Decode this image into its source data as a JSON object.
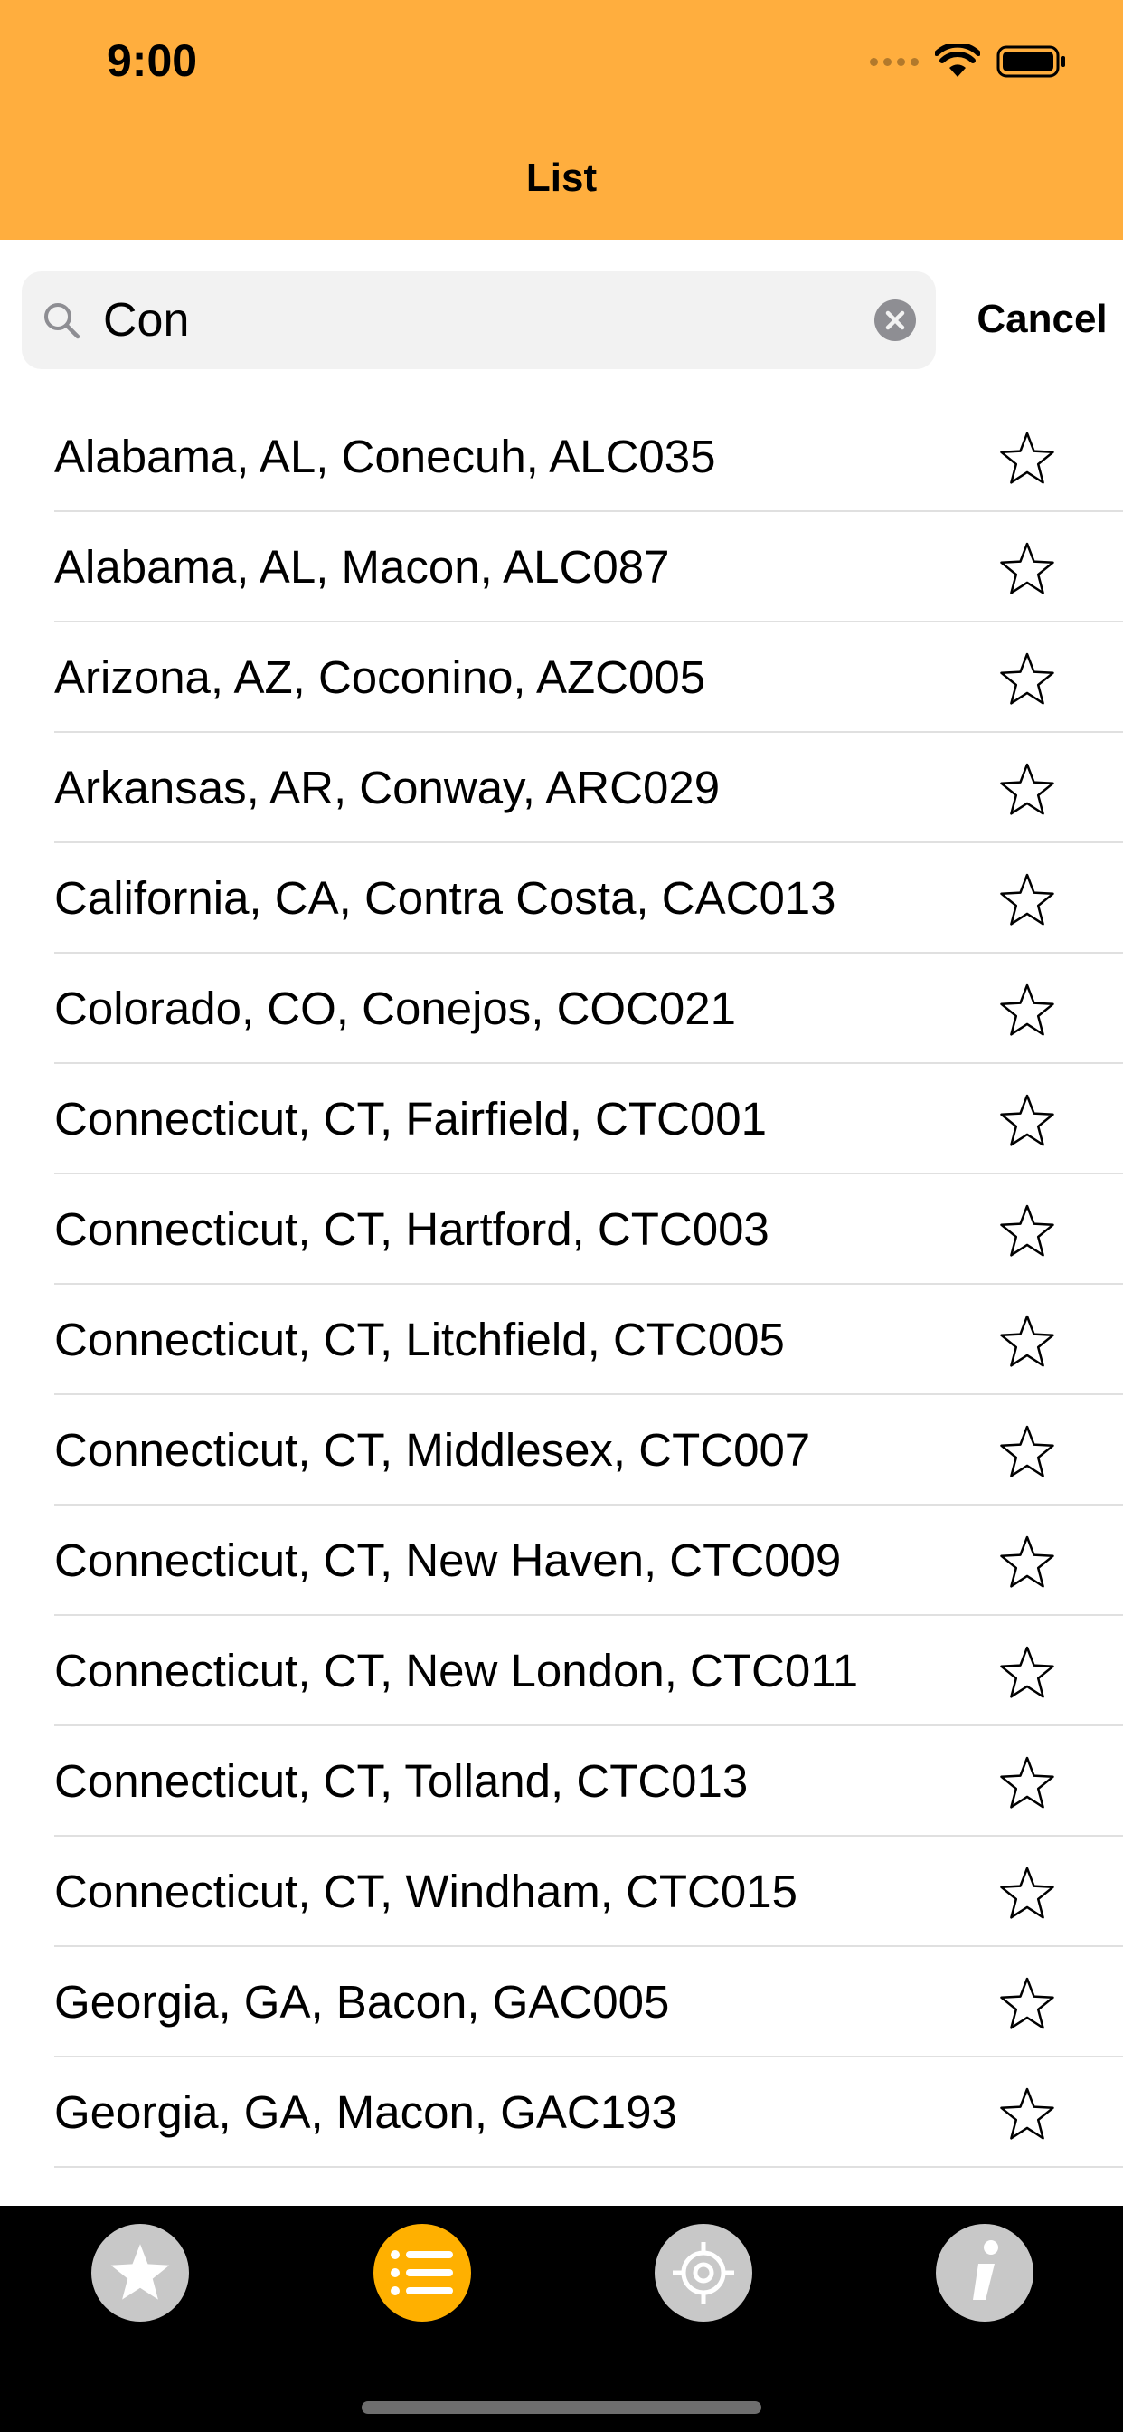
{
  "status_bar": {
    "time": "9:00"
  },
  "nav": {
    "title": "List"
  },
  "search": {
    "value": "Con",
    "cancel_label": "Cancel"
  },
  "list": {
    "items": [
      "Alabama, AL, Conecuh, ALC035",
      "Alabama, AL, Macon, ALC087",
      "Arizona, AZ, Coconino, AZC005",
      "Arkansas, AR, Conway, ARC029",
      "California, CA, Contra Costa, CAC013",
      "Colorado, CO, Conejos, COC021",
      "Connecticut, CT, Fairfield, CTC001",
      "Connecticut, CT, Hartford, CTC003",
      "Connecticut, CT, Litchfield, CTC005",
      "Connecticut, CT, Middlesex, CTC007",
      "Connecticut, CT, New Haven, CTC009",
      "Connecticut, CT, New London, CTC011",
      "Connecticut, CT, Tolland, CTC013",
      "Connecticut, CT, Windham, CTC015",
      "Georgia, GA, Bacon, GAC005",
      "Georgia, GA, Macon, GAC193"
    ]
  },
  "tabs": [
    {
      "icon": "star-icon",
      "active": false
    },
    {
      "icon": "list-icon",
      "active": true
    },
    {
      "icon": "location-target-icon",
      "active": false
    },
    {
      "icon": "info-icon",
      "active": false
    }
  ],
  "colors": {
    "header_bg": "#FFAE3E",
    "tab_active": "#FFB000",
    "tab_inactive": "#C8C8C8",
    "tab_bar_bg": "#000000"
  }
}
